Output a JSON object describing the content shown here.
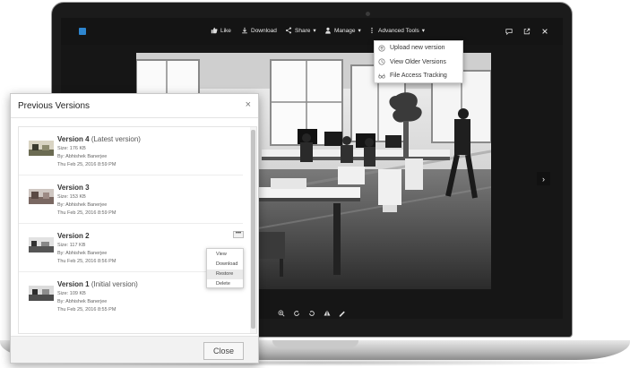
{
  "toolbar": {
    "like": "Like",
    "download": "Download",
    "share": "Share",
    "manage": "Manage",
    "advanced_tools": "Advanced Tools",
    "chevron": "▾"
  },
  "advanced_menu": {
    "items": [
      {
        "label": "Upload new version",
        "icon": "upload-circle-icon"
      },
      {
        "label": "View Older Versions",
        "icon": "clock-icon"
      },
      {
        "label": "File Access Tracking",
        "icon": "glasses-icon"
      }
    ]
  },
  "dialog": {
    "title": "Previous Versions",
    "close_icon": "×",
    "close_button": "Close",
    "versions": [
      {
        "name": "Version 4",
        "note": "(Latest version)",
        "size": "Size: 176 KB",
        "by": "By: Abhishek Banerjee",
        "date": "Thu Feb 25, 2016 8:59 PM"
      },
      {
        "name": "Version 3",
        "note": "",
        "size": "Size: 153 KB",
        "by": "By: Abhishek Banerjee",
        "date": "Thu Feb 25, 2016 8:59 PM"
      },
      {
        "name": "Version 2",
        "note": "",
        "size": "Size: 117 KB",
        "by": "By: Abhishek Banerjee",
        "date": "Thu Feb 25, 2016 8:56 PM"
      },
      {
        "name": "Version 1",
        "note": "(Initial version)",
        "size": "Size: 109 KB",
        "by": "By: Abhishek Banerjee",
        "date": "Thu Feb 25, 2016 8:55 PM"
      }
    ],
    "more_button": "•••",
    "context_menu": [
      "View",
      "Download",
      "Restore",
      "Delete"
    ]
  },
  "viewer": {
    "next_icon": "›"
  },
  "colors": {
    "toolbar_bg": "#141414",
    "logo": "#2e86d0",
    "dialog_border": "#c9c9c9"
  }
}
